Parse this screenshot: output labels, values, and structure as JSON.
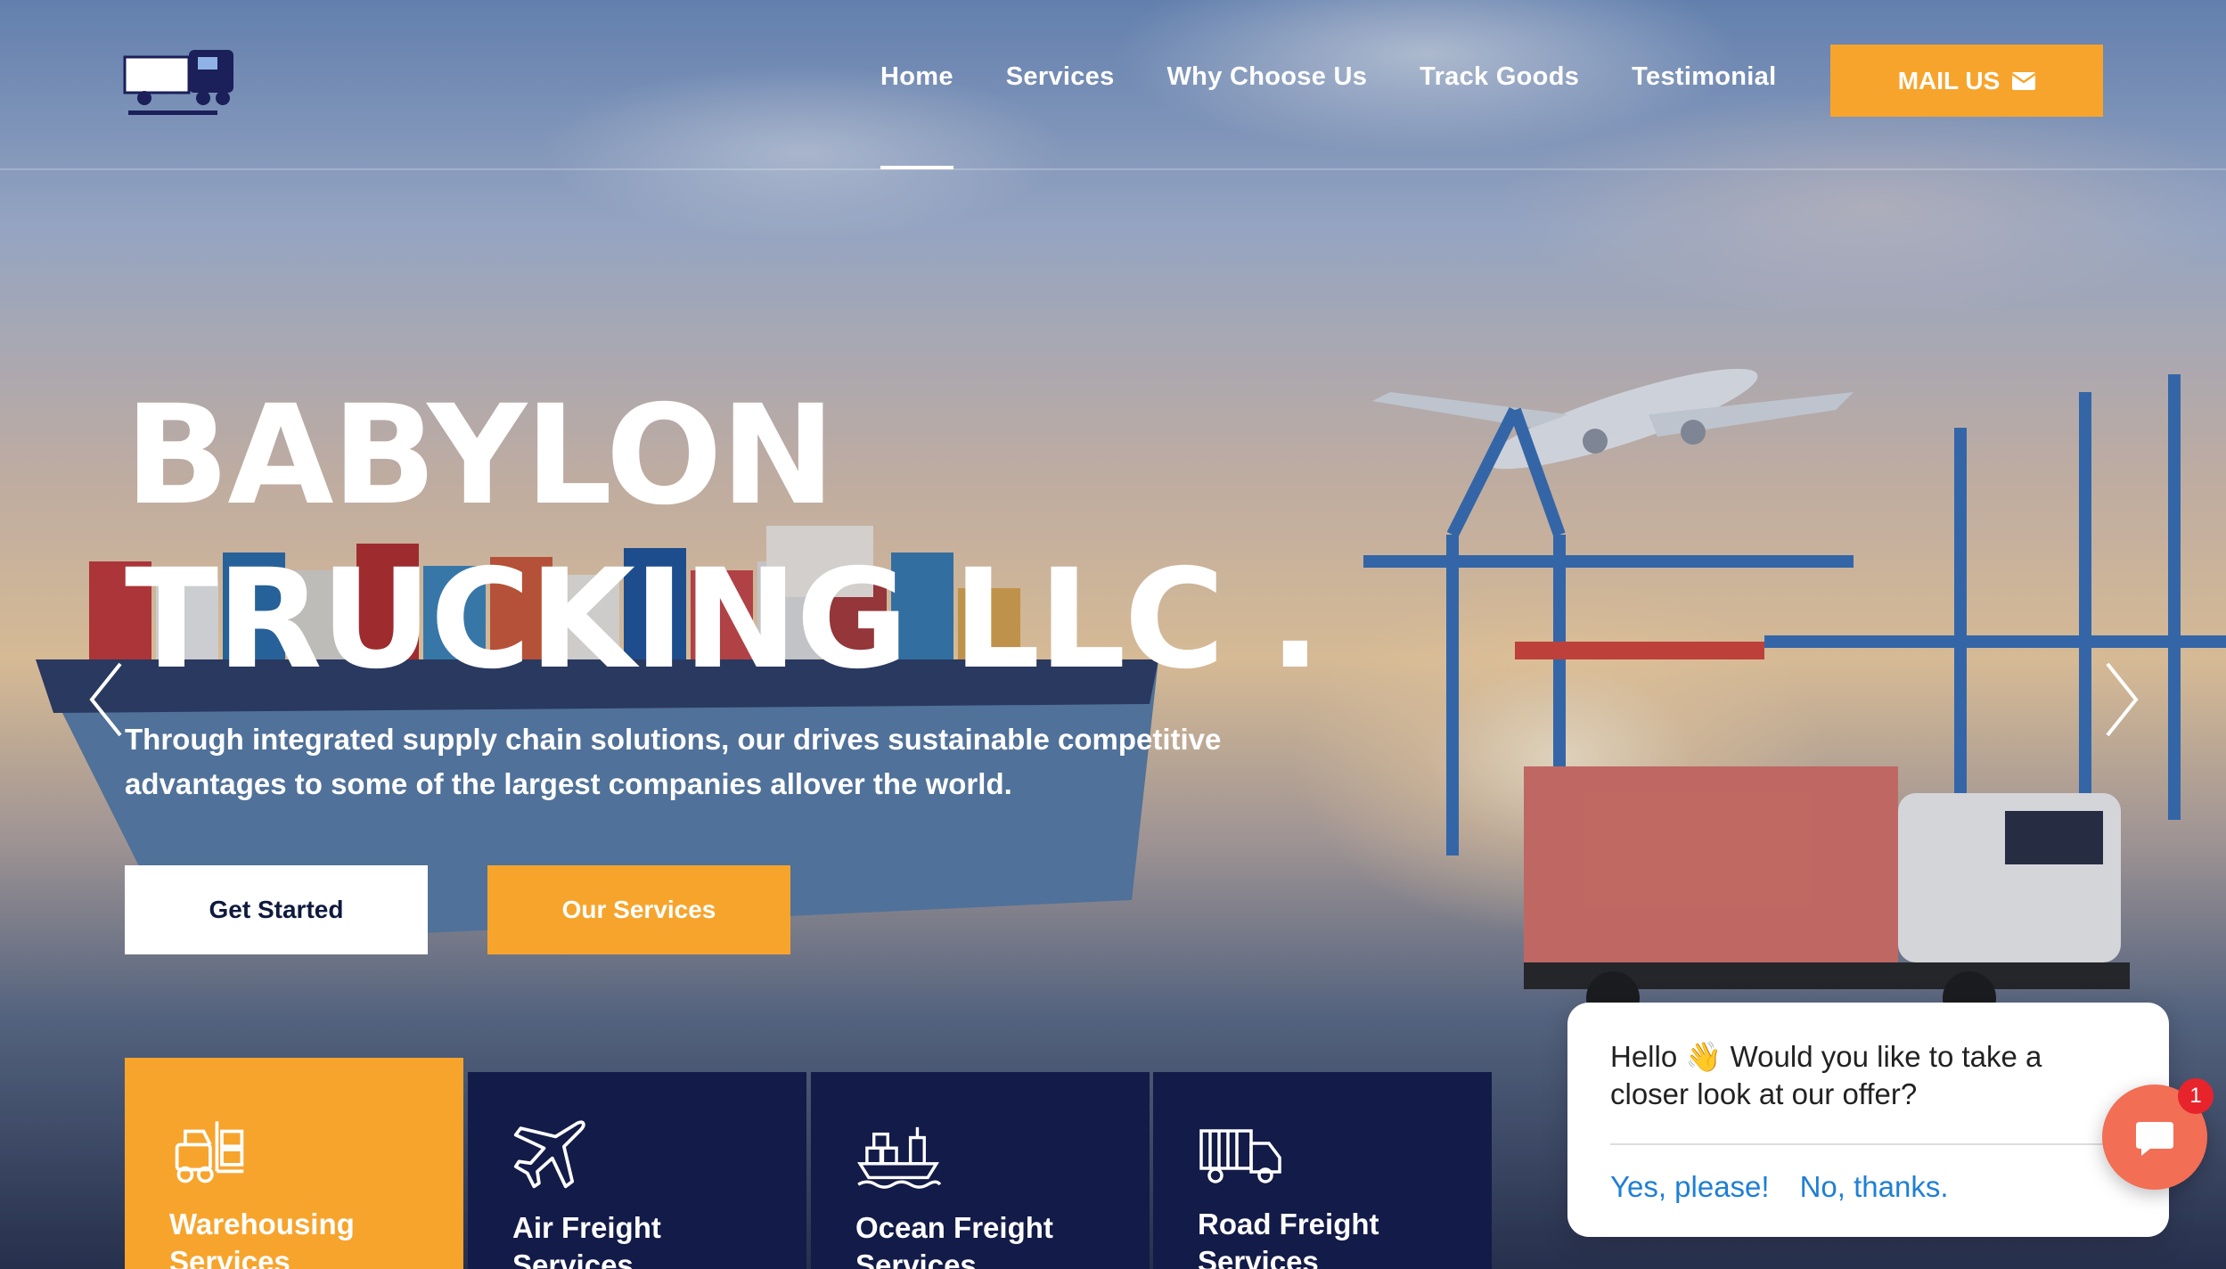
{
  "nav": {
    "items": [
      "Home",
      "Services",
      "Why Choose Us",
      "Track Goods",
      "Testimonial"
    ],
    "active": "Home",
    "mail_button": "MAIL US"
  },
  "hero": {
    "title_line1": "BABYLON",
    "title_line2": "TRUCKING LLC .",
    "subtitle": "Through integrated supply chain solutions, our drives sustainable competitive advantages to some of the largest companies allover the world.",
    "primary_button": "Get Started",
    "secondary_button": "Our Services"
  },
  "services": [
    {
      "label": "Warehousing Services",
      "icon": "forklift-icon"
    },
    {
      "label": "Air Freight Services",
      "icon": "airplane-icon"
    },
    {
      "label": "Ocean Freight Services",
      "icon": "cargo-ship-icon"
    },
    {
      "label": "Road Freight Services",
      "icon": "truck-icon"
    }
  ],
  "chat": {
    "message": "Hello 👋 Would you like to take a closer look at our offer?",
    "yes": "Yes, please!",
    "no": "No, thanks.",
    "badge": "1"
  },
  "colors": {
    "accent": "#f7a42d",
    "navy": "#131b48",
    "chat_accent": "#f26e55",
    "link": "#1e7fd6"
  }
}
